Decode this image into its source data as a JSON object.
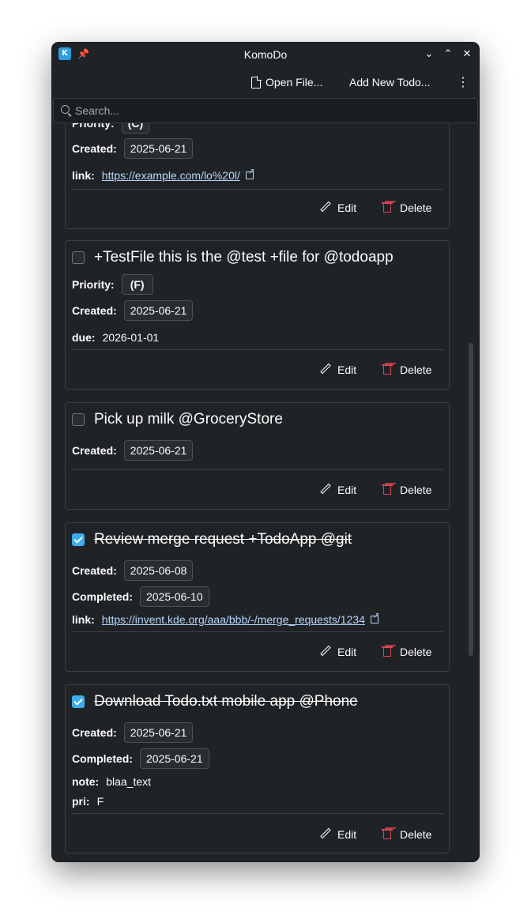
{
  "window": {
    "title": "KomoDo",
    "app_icon_glyph": "K",
    "pin_glyph": "📌",
    "minimize_glyph": "⌄",
    "maximize_glyph": "⌃",
    "close_glyph": "✕"
  },
  "toolbar": {
    "open_file_label": "Open File...",
    "add_todo_label": "Add New Todo...",
    "menu_glyph": "⋮"
  },
  "search": {
    "placeholder": "Search...",
    "value": ""
  },
  "labels": {
    "priority": "Priority:",
    "created": "Created:",
    "completed": "Completed:",
    "edit": "Edit",
    "delete": "Delete"
  },
  "todos": [
    {
      "title": "",
      "done": false,
      "priority": "(C)",
      "created": "2025-06-21",
      "extras": [
        {
          "key": "link:",
          "value": "https://example.com/lo%20l/",
          "is_link": true
        }
      ]
    },
    {
      "title": "+TestFile this is the @test +file for @todoapp",
      "done": false,
      "priority": "(F)",
      "created": "2025-06-21",
      "extras": [
        {
          "key": "due:",
          "value": "2026-01-01",
          "is_link": false
        }
      ]
    },
    {
      "title": "Pick up milk @GroceryStore",
      "done": false,
      "created": "2025-06-21"
    },
    {
      "title": "Review merge request +TodoApp @git",
      "done": true,
      "created": "2025-06-08",
      "completed": "2025-06-10",
      "extras": [
        {
          "key": "link:",
          "value": "https://invent.kde.org/aaa/bbb/-/merge_requests/1234",
          "is_link": true
        }
      ]
    },
    {
      "title": "Download Todo.txt mobile app @Phone",
      "done": true,
      "created": "2025-06-21",
      "completed": "2025-06-21",
      "extras": [
        {
          "key": "note:",
          "value": "blaa_text",
          "is_link": false
        },
        {
          "key": "pri:",
          "value": "F",
          "is_link": false
        }
      ]
    }
  ],
  "colors": {
    "background": "#202326",
    "border": "#3d4144",
    "link": "#b8d7ff",
    "accent": "#3daee9",
    "delete": "#da4453"
  }
}
